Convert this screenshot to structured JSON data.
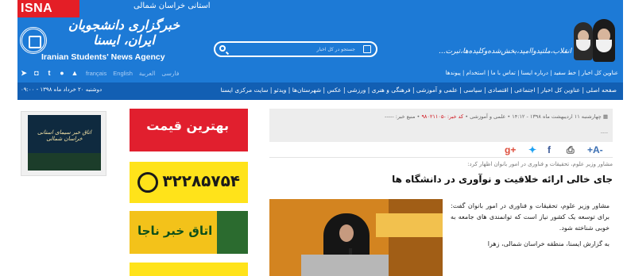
{
  "header": {
    "brand_tag": "ISNA",
    "region": "استانی خراسان شمالی",
    "logo_fa": "خبرگزاری دانشجویان ایران، ایسنا",
    "logo_en": "Iranian Students' News Agency",
    "quote": "انقلاب،ملتیدوا‌امید،بخش‌شده‌وکلیده‌ها،تبرت...",
    "search_placeholder": "جستجو در کل اخبار",
    "langs": [
      "français",
      "English",
      "العربیة",
      "فارسی"
    ],
    "social_icons": [
      "telegram-icon",
      "instagram-icon",
      "twitter-icon",
      "apple-icon",
      "android-icon"
    ],
    "nav1": "عناوین کل اخبار | خط سفید | درباره ایسنا | تماس با ما | استخدام | پیوندها"
  },
  "navbar2": {
    "date": "دوشنبه ۲۰ خرداد ماه ۱۳۹۸ - ۰۹:۰۰",
    "items": "صفحه اصلی | عناوین کل اخبار | اجتماعی | اقتصادی | سیاسی | علمی و آموزشی | فرهنگی و هنری | ورزشی | عکس | شهرستان‌ها | ویدئو | سایت مرکزی ایسنا"
  },
  "sidebar": {
    "banner_caption": "اتاق خبر سیمای استانی خراسان شمالی"
  },
  "ads": {
    "ad1": "بهترین قیمت",
    "ad2": "۳۲۲۸۵۷۵۴",
    "ad3": "اتاق خبر ناجا"
  },
  "article": {
    "meta_line1_left": "منبع خبر: -----",
    "meta_date": "چهارشنبه ۱۱ اردیبهشت ماه ۱۳۹۸ - ۱۴:۱۲",
    "meta_category": "علمی و آموزشی",
    "meta_code_label": "کد خبر:",
    "meta_code": "-۹۸۰۲۱۱۰۵",
    "meta_line2": "----",
    "share_icons": [
      "google-plus-icon",
      "twitter-icon",
      "facebook-icon",
      "print-icon",
      "font-size-icon"
    ],
    "font_size_label": "+A-",
    "kicker": "مشاور وزیر علوم، تحقیقات و فناوری در امور بانوان اظهار کرد:",
    "headline": "جای خالی ارائه خلاقیت و نوآوری در دانشگاه ها",
    "paragraph1": "مشاور وزیر علوم، تحقیقات و فناوری در امور بانوان گفت: برای توسعه یک کشور نیاز است که توانمندی های جامعه به خوبی شناخته شود.",
    "paragraph2": "به گزارش ایسنا، منطقه خراسان شمالی، زهرا"
  }
}
